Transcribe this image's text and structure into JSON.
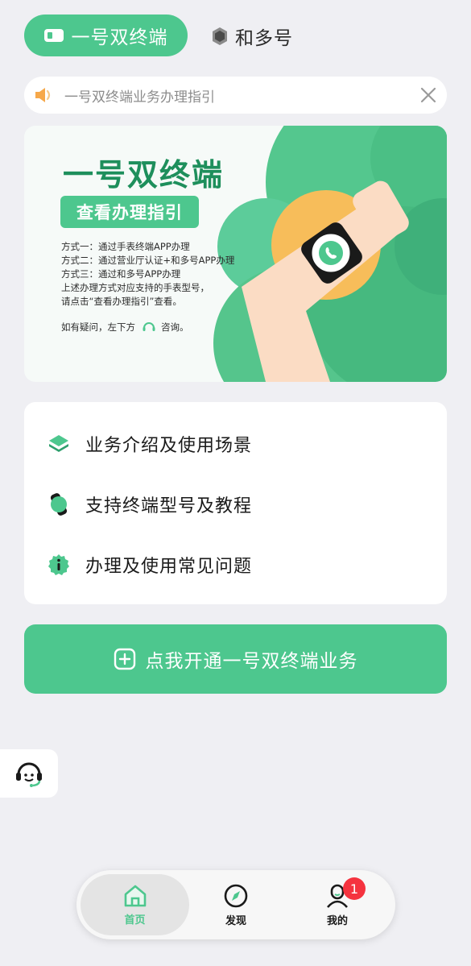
{
  "tabs": {
    "active_label": "一号双终端",
    "idle_label": "和多号"
  },
  "notice": {
    "text": "一号双终端业务办理指引"
  },
  "banner": {
    "headline": "一号双终端",
    "guide_button": "查看办理指引",
    "ways": [
      "方式一：通过手表终端APP办理",
      "方式二：通过营业厅认证+和多号APP办理",
      "方式三：通过和多号APP办理",
      "上述办理方式对应支持的手表型号，",
      "请点击“查看办理指引”查看。"
    ],
    "ask_prefix": "如有疑问，左下方",
    "ask_suffix": "咨询。"
  },
  "menu": {
    "items": [
      {
        "label": "业务介绍及使用场景",
        "icon": "layers-icon"
      },
      {
        "label": "支持终端型号及教程",
        "icon": "watch-icon"
      },
      {
        "label": "办理及使用常见问题",
        "icon": "info-badge-icon"
      }
    ]
  },
  "cta": {
    "label": "点我开通一号双终端业务"
  },
  "bottom_nav": {
    "items": [
      {
        "label": "首页",
        "icon": "home-icon",
        "active": true
      },
      {
        "label": "发现",
        "icon": "compass-icon",
        "active": false
      },
      {
        "label": "我的",
        "icon": "profile-icon",
        "active": false
      }
    ],
    "badge_count": "1"
  },
  "colors": {
    "accent": "#4dc78e",
    "accent_dark": "#1e8f5c",
    "badge": "#f5333f",
    "background": "#efeff3"
  }
}
